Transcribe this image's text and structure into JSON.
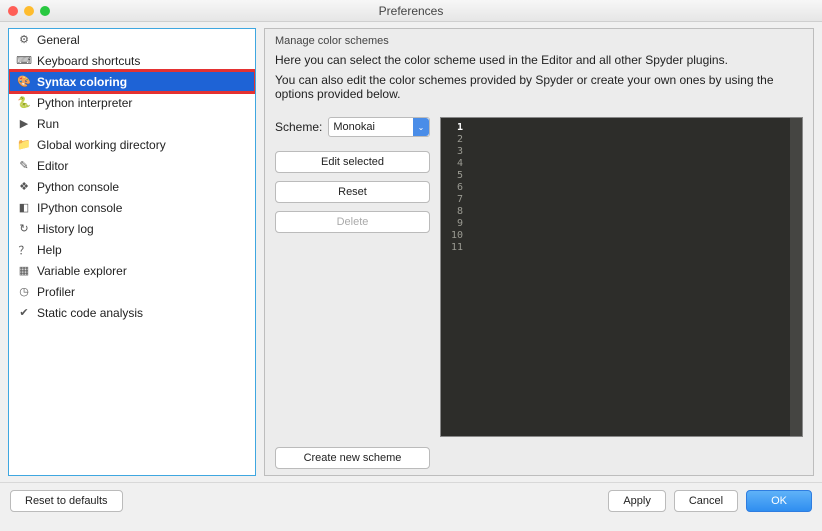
{
  "window": {
    "title": "Preferences"
  },
  "sidebar": {
    "items": [
      {
        "label": "General",
        "icon": "gear-icon"
      },
      {
        "label": "Keyboard shortcuts",
        "icon": "keyboard-icon"
      },
      {
        "label": "Syntax coloring",
        "icon": "palette-icon",
        "selected": true
      },
      {
        "label": "Python interpreter",
        "icon": "python-icon"
      },
      {
        "label": "Run",
        "icon": "play-icon"
      },
      {
        "label": "Global working directory",
        "icon": "folder-icon"
      },
      {
        "label": "Editor",
        "icon": "pencil-icon"
      },
      {
        "label": "Python console",
        "icon": "python-console-icon"
      },
      {
        "label": "IPython console",
        "icon": "ipython-icon"
      },
      {
        "label": "History log",
        "icon": "history-icon"
      },
      {
        "label": "Help",
        "icon": "help-icon"
      },
      {
        "label": "Variable explorer",
        "icon": "table-icon"
      },
      {
        "label": "Profiler",
        "icon": "clock-icon"
      },
      {
        "label": "Static code analysis",
        "icon": "checklist-icon"
      }
    ]
  },
  "panel": {
    "title": "Manage color schemes",
    "desc1": "Here you can select the color scheme used in the Editor and all other Spyder plugins.",
    "desc2": "You can also edit the color schemes provided by Spyder or create your own ones by using the options provided below.",
    "scheme_label": "Scheme:",
    "scheme_value": "Monokai",
    "buttons": {
      "edit": "Edit selected",
      "reset": "Reset",
      "delete": "Delete",
      "create": "Create new scheme"
    },
    "preview_lines": [
      "1",
      "2",
      "3",
      "4",
      "5",
      "6",
      "7",
      "8",
      "9",
      "10",
      "11"
    ]
  },
  "footer": {
    "reset": "Reset to defaults",
    "apply": "Apply",
    "cancel": "Cancel",
    "ok": "OK"
  }
}
